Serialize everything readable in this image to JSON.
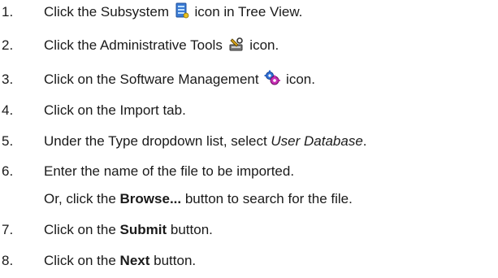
{
  "steps": [
    {
      "number": "1.",
      "before": "Click the Subsystem ",
      "icon": "subsystem-icon",
      "after": " icon in Tree View."
    },
    {
      "number": "2.",
      "before": "Click the Administrative Tools ",
      "icon": "administrative-tools-icon",
      "after": " icon."
    },
    {
      "number": "3.",
      "before": "Click on the Software Management ",
      "icon": "software-management-icon",
      "after": " icon."
    },
    {
      "number": "4.",
      "text": "Click on the Import tab."
    },
    {
      "number": "5.",
      "before": "Under the Type dropdown list, select ",
      "italic": "User Database",
      "after": "."
    },
    {
      "number": "6.",
      "text": "Enter the name of the file to be imported.",
      "continuation": {
        "before": "Or, click the ",
        "bold": "Browse...",
        "after": " button to search for the file."
      }
    },
    {
      "number": "7.",
      "before": "Click on the ",
      "bold": "Submit",
      "after": " button."
    },
    {
      "number": "8.",
      "before": "Click on the ",
      "bold": "Next",
      "after": " button."
    }
  ],
  "colors": {
    "text": "#1a1a1a",
    "subsystem_icon": "#3a7bd5",
    "admin_tools_icon": "#555555",
    "software_mgmt_primary": "#2f6fd6",
    "software_mgmt_secondary": "#c72fb5"
  }
}
